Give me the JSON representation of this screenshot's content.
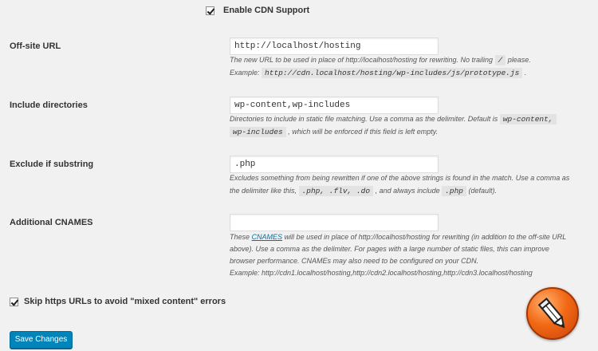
{
  "enable_cdn": {
    "label": "Enable CDN Support",
    "checked": true
  },
  "offsite_url": {
    "label": "Off-site URL",
    "value": "http://localhost/hosting",
    "desc_1": "The new URL to be used in place of http://localhost/hosting for rewriting. No trailing",
    "code_1": "/",
    "desc_2": "please.",
    "desc_3": "Example:",
    "code_2": "http://cdn.localhost/hosting/wp-includes/js/prototype.js",
    "desc_4": "."
  },
  "include_dirs": {
    "label": "Include directories",
    "value": "wp-content,wp-includes",
    "desc_1": "Directories to include in static file matching. Use a comma as the delimiter. Default is",
    "code_1": "wp-content,",
    "code_2": "wp-includes",
    "desc_2": ", which will be enforced if this field is left empty."
  },
  "exclude_substring": {
    "label": "Exclude if substring",
    "value": ".php",
    "desc_1": "Excludes something from being rewritten if one of the above strings is found in the match. Use a comma as",
    "desc_2": "the delimiter like this,",
    "code_1": ".php, .flv, .do",
    "desc_3": ", and always include",
    "code_2": ".php",
    "desc_4": "(default)."
  },
  "cnames": {
    "label": "Additional CNAMES",
    "value": "",
    "desc_1": "These",
    "link": "CNAMES",
    "desc_2": "will be used in place of http://localhost/hosting for rewriting (in addition to the off-site URL",
    "desc_3": "above). Use a comma as the delimiter. For pages with a large number of static files, this can improve",
    "desc_4": "browser performance. CNAMEs may also need to be configured on your CDN.",
    "desc_5": "Example: http://cdn1.localhost/hosting,http://cdn2.localhost/hosting,http://cdn3.localhost/hosting"
  },
  "skip_https": {
    "label": "Skip https URLs to avoid \"mixed content\" errors",
    "checked": true
  },
  "save_button": "Save Changes",
  "logo_icon": "pencil-logo-icon"
}
